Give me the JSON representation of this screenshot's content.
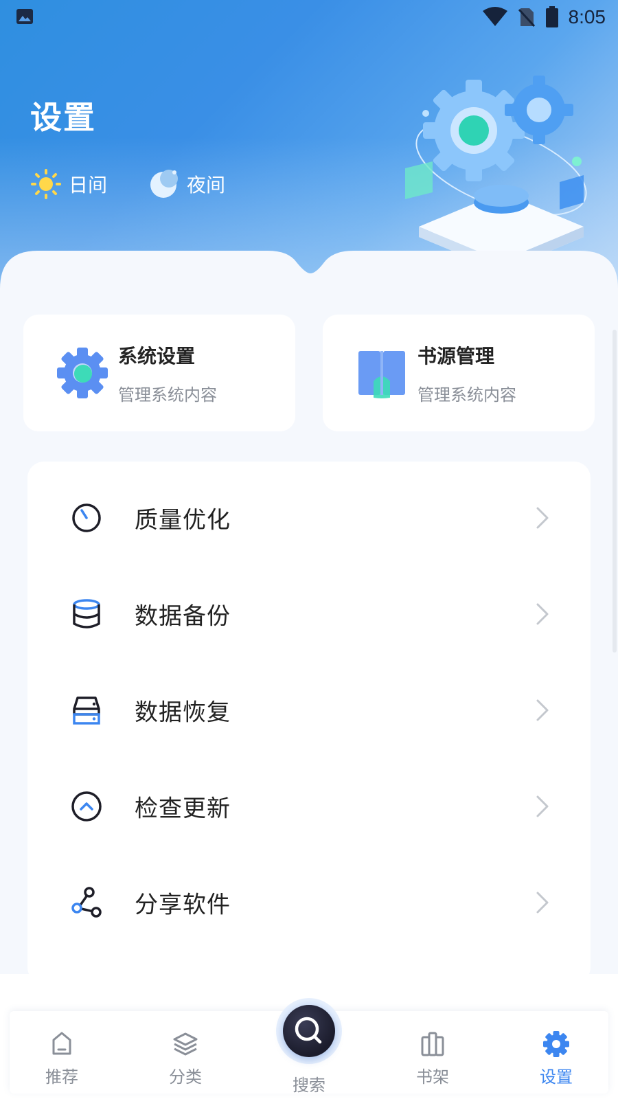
{
  "status_bar": {
    "time": "8:05"
  },
  "header": {
    "title": "设置",
    "modes": [
      {
        "label": "日间",
        "icon": "sun-icon"
      },
      {
        "label": "夜间",
        "icon": "moon-icon"
      }
    ]
  },
  "quick_cards": [
    {
      "title": "系统设置",
      "subtitle": "管理系统内容",
      "icon": "gear-icon"
    },
    {
      "title": "书源管理",
      "subtitle": "管理系统内容",
      "icon": "book-icon"
    }
  ],
  "menu": [
    {
      "label": "质量优化",
      "icon": "timer-icon"
    },
    {
      "label": "数据备份",
      "icon": "database-icon"
    },
    {
      "label": "数据恢复",
      "icon": "server-icon"
    },
    {
      "label": "检查更新",
      "icon": "chevron-up-circle-icon"
    },
    {
      "label": "分享软件",
      "icon": "share-icon"
    }
  ],
  "bottom_nav": [
    {
      "label": "推荐",
      "icon": "home-icon",
      "active": false
    },
    {
      "label": "分类",
      "icon": "layers-icon",
      "active": false
    },
    {
      "label": "搜索",
      "icon": "search-icon",
      "active": false
    },
    {
      "label": "书架",
      "icon": "bookshelf-icon",
      "active": false
    },
    {
      "label": "设置",
      "icon": "settings-icon",
      "active": true
    }
  ],
  "colors": {
    "accent": "#3c86f0",
    "header_blue": "#2f8fe0",
    "text_dark": "#222222",
    "text_muted": "#8a8f98"
  }
}
